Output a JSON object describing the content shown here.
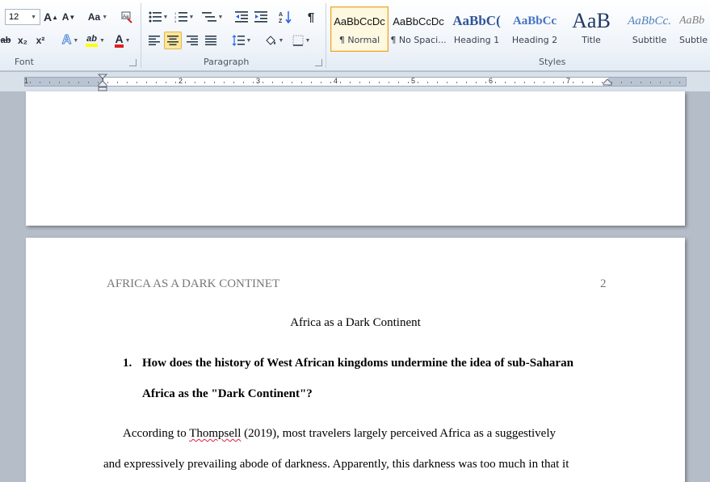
{
  "ribbon": {
    "font_size": "12",
    "groups": {
      "font": "Font",
      "paragraph": "Paragraph",
      "styles": "Styles"
    },
    "font_buttons": {
      "grow": "A",
      "shrink": "A",
      "change_case": "Aa",
      "subscript": "x₂",
      "superscript": "x²",
      "text_effects": "A",
      "highlight": "ab",
      "font_color": "A"
    },
    "highlight_color": "#ffff00",
    "font_color": "#e02020",
    "styles": [
      {
        "preview": "AaBbCcDc",
        "name": "¶ Normal"
      },
      {
        "preview": "AaBbCcDc",
        "name": "¶ No Spaci..."
      },
      {
        "preview": "AaBbC(",
        "name": "Heading 1"
      },
      {
        "preview": "AaBbCc",
        "name": "Heading 2"
      },
      {
        "preview": "AaB",
        "name": "Title"
      },
      {
        "preview": "AaBbCc.",
        "name": "Subtitle"
      },
      {
        "preview": "AaBb",
        "name": "Subtle"
      }
    ]
  },
  "ruler": {
    "numbers": [
      "1",
      "1",
      "2",
      "3",
      "4",
      "5",
      "6",
      "7"
    ]
  },
  "document": {
    "running_head": "AFRICA AS A DARK CONTINET",
    "page_number": "2",
    "title": "Africa as a Dark Continent",
    "question_number": "1.",
    "question_line1": "How does the history of West African kingdoms undermine the idea of sub-Saharan",
    "question_line2": "Africa as the \"Dark Continent\"?",
    "para_line1_pre": "According to ",
    "para_line1_cite": "Thompsell",
    "para_line1_post": " (2019), most travelers largely perceived Africa as a suggestively",
    "para_line2": "and expressively prevailing  abode of darkness. Apparently, this darkness was too much in that it"
  }
}
